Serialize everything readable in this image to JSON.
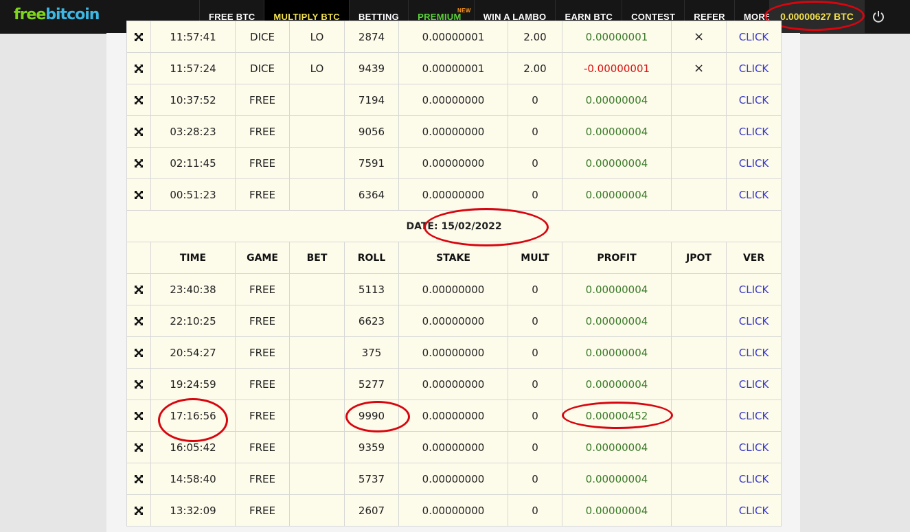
{
  "nav": {
    "logo_free": "free",
    "logo_bitcoin": "bitcoin",
    "links": [
      {
        "label": "FREE BTC",
        "name": "nav-free-btc"
      },
      {
        "label": "MULTIPLY BTC",
        "name": "nav-multiply-btc"
      },
      {
        "label": "BETTING",
        "name": "nav-betting"
      },
      {
        "label": "PREMIUM",
        "name": "nav-premium",
        "tag": "NEW"
      },
      {
        "label": "WIN A LAMBO",
        "name": "nav-win-a-lambo"
      },
      {
        "label": "EARN BTC",
        "name": "nav-earn-btc"
      },
      {
        "label": "CONTEST",
        "name": "nav-contest"
      },
      {
        "label": "REFER",
        "name": "nav-refer"
      },
      {
        "label": "MORE",
        "name": "nav-more",
        "icon": "double-chevron-down-icon"
      }
    ],
    "active": "MULTIPLY BTC",
    "balance": "0.00000627 BTC",
    "power_icon": "power-icon"
  },
  "colors": {
    "profit_positive": "#3a7a2a",
    "profit_negative": "#d11111",
    "click_link": "#3838c9",
    "annotation": "#d8050f",
    "table_bg": "#fdfbea"
  },
  "rows_top": [
    {
      "time": "11:57:41",
      "game": "DICE",
      "bet": "LO",
      "roll": "2874",
      "stake": "0.00000001",
      "mult": "2.00",
      "profit": "0.00000001",
      "jpot": "×",
      "ver": "CLICK",
      "sign": "pos"
    },
    {
      "time": "11:57:24",
      "game": "DICE",
      "bet": "LO",
      "roll": "9439",
      "stake": "0.00000001",
      "mult": "2.00",
      "profit": "-0.00000001",
      "jpot": "×",
      "ver": "CLICK",
      "sign": "neg"
    },
    {
      "time": "10:37:52",
      "game": "FREE",
      "bet": "",
      "roll": "7194",
      "stake": "0.00000000",
      "mult": "0",
      "profit": "0.00000004",
      "jpot": "",
      "ver": "CLICK",
      "sign": "pos"
    },
    {
      "time": "03:28:23",
      "game": "FREE",
      "bet": "",
      "roll": "9056",
      "stake": "0.00000000",
      "mult": "0",
      "profit": "0.00000004",
      "jpot": "",
      "ver": "CLICK",
      "sign": "pos"
    },
    {
      "time": "02:11:45",
      "game": "FREE",
      "bet": "",
      "roll": "7591",
      "stake": "0.00000000",
      "mult": "0",
      "profit": "0.00000004",
      "jpot": "",
      "ver": "CLICK",
      "sign": "pos"
    },
    {
      "time": "00:51:23",
      "game": "FREE",
      "bet": "",
      "roll": "6364",
      "stake": "0.00000000",
      "mult": "0",
      "profit": "0.00000004",
      "jpot": "",
      "ver": "CLICK",
      "sign": "pos"
    }
  ],
  "date_label": "DATE: 15/02/2022",
  "headers": {
    "time": "TIME",
    "game": "GAME",
    "bet": "BET",
    "roll": "ROLL",
    "stake": "STAKE",
    "mult": "MULT",
    "profit": "PROFIT",
    "jpot": "JPOT",
    "ver": "VER"
  },
  "rows_bottom": [
    {
      "time": "23:40:38",
      "game": "FREE",
      "bet": "",
      "roll": "5113",
      "stake": "0.00000000",
      "mult": "0",
      "profit": "0.00000004",
      "jpot": "",
      "ver": "CLICK",
      "sign": "pos"
    },
    {
      "time": "22:10:25",
      "game": "FREE",
      "bet": "",
      "roll": "6623",
      "stake": "0.00000000",
      "mult": "0",
      "profit": "0.00000004",
      "jpot": "",
      "ver": "CLICK",
      "sign": "pos"
    },
    {
      "time": "20:54:27",
      "game": "FREE",
      "bet": "",
      "roll": "375",
      "stake": "0.00000000",
      "mult": "0",
      "profit": "0.00000004",
      "jpot": "",
      "ver": "CLICK",
      "sign": "pos"
    },
    {
      "time": "19:24:59",
      "game": "FREE",
      "bet": "",
      "roll": "5277",
      "stake": "0.00000000",
      "mult": "0",
      "profit": "0.00000004",
      "jpot": "",
      "ver": "CLICK",
      "sign": "pos"
    },
    {
      "time": "17:16:56",
      "game": "FREE",
      "bet": "",
      "roll": "9990",
      "stake": "0.00000000",
      "mult": "0",
      "profit": "0.00000452",
      "jpot": "",
      "ver": "CLICK",
      "sign": "pos"
    },
    {
      "time": "16:05:42",
      "game": "FREE",
      "bet": "",
      "roll": "9359",
      "stake": "0.00000000",
      "mult": "0",
      "profit": "0.00000004",
      "jpot": "",
      "ver": "CLICK",
      "sign": "pos"
    },
    {
      "time": "14:58:40",
      "game": "FREE",
      "bet": "",
      "roll": "5737",
      "stake": "0.00000000",
      "mult": "0",
      "profit": "0.00000004",
      "jpot": "",
      "ver": "CLICK",
      "sign": "pos"
    },
    {
      "time": "13:32:09",
      "game": "FREE",
      "bet": "",
      "roll": "2607",
      "stake": "0.00000000",
      "mult": "0",
      "profit": "0.00000004",
      "jpot": "",
      "ver": "CLICK",
      "sign": "pos"
    }
  ]
}
